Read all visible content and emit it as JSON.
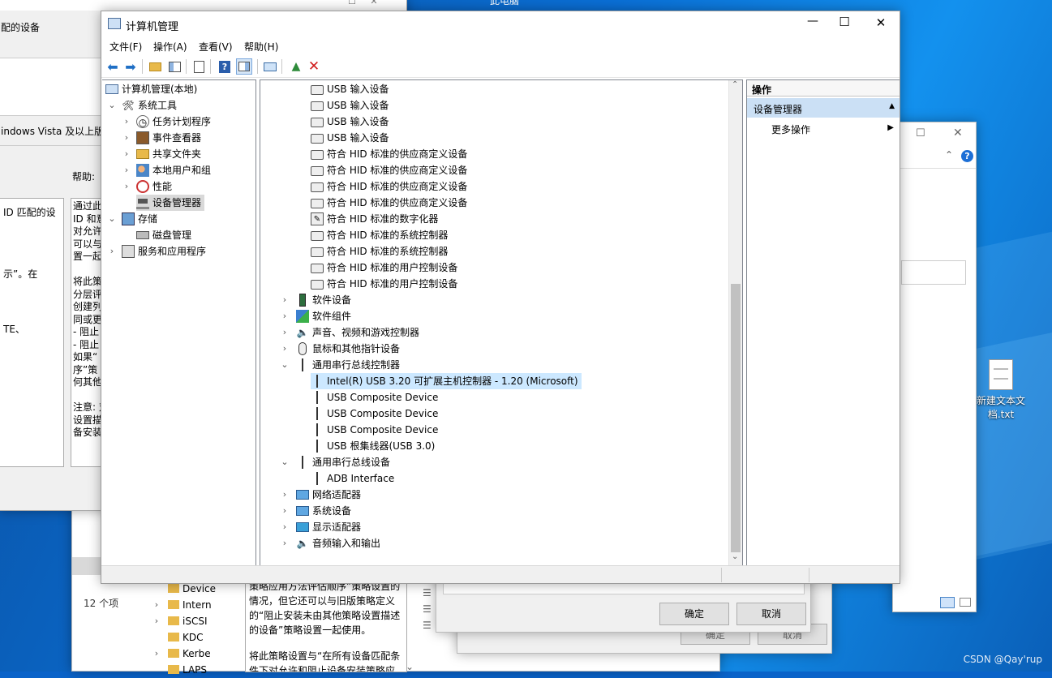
{
  "bg_left_window": {
    "title_partial": "配的设备",
    "vista_text": "indows Vista 及以上版",
    "help_label": "帮助:",
    "left_lines": [
      "ID 匹配的设",
      "",
      "",
      "示”。在",
      "",
      "",
      "TE、"
    ],
    "help_lines": [
      "通过此",
      "ID 和意",
      "对允许",
      "可以与",
      "置一起",
      "",
      "将此策",
      "分层评",
      "创建列",
      "同或更",
      "- 阻止",
      "- 阻止",
      "如果“",
      "序”策",
      "何其他",
      "",
      "注意: 对",
      "设置描",
      "备安装"
    ]
  },
  "bg_bottom_window": {
    "count_text": "12 个项",
    "folders": [
      "Device",
      "Intern",
      "iSCSI",
      "KDC",
      "Kerbe",
      "LAPS"
    ],
    "desc_lines": [
      "策略应用方法评估顺序”策略设置的",
      "情况，但它还可以与旧版策略定义",
      "的“阻止安装未由其他策略设置描述",
      "的设备”策略设置一起使用。",
      "",
      "将此策略设置与“在所有设备匹配条",
      "件下对允许和阻止设备安装策略应"
    ],
    "ok_label": "确定",
    "cancel_label": "取消"
  },
  "bg_right_window": {
    "help_icon": "?"
  },
  "desktop_icon": {
    "label_line1": "新建文本文",
    "label_line2": "档.txt"
  },
  "watermark": "CSDN @Qay'rup",
  "top_partial_text": "此电脑",
  "window": {
    "title": "计算机管理",
    "controls": {
      "minimize": "—",
      "maximize": "☐",
      "close": "✕"
    },
    "menu": [
      "文件(F)",
      "操作(A)",
      "查看(V)",
      "帮助(H)"
    ]
  },
  "tree": {
    "root": "计算机管理(本地)",
    "items": [
      {
        "label": "系统工具",
        "level": 1,
        "expander": "⌄",
        "icon": "tools-icon"
      },
      {
        "label": "任务计划程序",
        "level": 2,
        "expander": "›",
        "icon": "clock-icon"
      },
      {
        "label": "事件查看器",
        "level": 2,
        "expander": "›",
        "icon": "event-viewer-icon"
      },
      {
        "label": "共享文件夹",
        "level": 2,
        "expander": "›",
        "icon": "shared-folder-icon"
      },
      {
        "label": "本地用户和组",
        "level": 2,
        "expander": "›",
        "icon": "users-icon"
      },
      {
        "label": "性能",
        "level": 2,
        "expander": "›",
        "icon": "performance-icon"
      },
      {
        "label": "设备管理器",
        "level": 2,
        "expander": "",
        "icon": "device-manager-icon",
        "selected": true
      },
      {
        "label": "存储",
        "level": 1,
        "expander": "⌄",
        "icon": "storage-icon"
      },
      {
        "label": "磁盘管理",
        "level": 2,
        "expander": "",
        "icon": "disk-icon"
      },
      {
        "label": "服务和应用程序",
        "level": 1,
        "expander": "›",
        "icon": "services-icon"
      }
    ]
  },
  "devices": [
    {
      "label": "USB 输入设备",
      "level": 2,
      "icon": "hid-icon"
    },
    {
      "label": "USB 输入设备",
      "level": 2,
      "icon": "hid-icon"
    },
    {
      "label": "USB 输入设备",
      "level": 2,
      "icon": "hid-icon"
    },
    {
      "label": "USB 输入设备",
      "level": 2,
      "icon": "hid-icon"
    },
    {
      "label": "符合 HID 标准的供应商定义设备",
      "level": 2,
      "icon": "hid-icon"
    },
    {
      "label": "符合 HID 标准的供应商定义设备",
      "level": 2,
      "icon": "hid-icon"
    },
    {
      "label": "符合 HID 标准的供应商定义设备",
      "level": 2,
      "icon": "hid-icon"
    },
    {
      "label": "符合 HID 标准的供应商定义设备",
      "level": 2,
      "icon": "hid-icon"
    },
    {
      "label": "符合 HID 标准的数字化器",
      "level": 2,
      "icon": "digitizer-icon"
    },
    {
      "label": "符合 HID 标准的系统控制器",
      "level": 2,
      "icon": "hid-icon"
    },
    {
      "label": "符合 HID 标准的系统控制器",
      "level": 2,
      "icon": "hid-icon"
    },
    {
      "label": "符合 HID 标准的用户控制设备",
      "level": 2,
      "icon": "hid-icon"
    },
    {
      "label": "符合 HID 标准的用户控制设备",
      "level": 2,
      "icon": "hid-icon"
    },
    {
      "label": "软件设备",
      "level": 1,
      "expander": "›",
      "icon": "software-device-icon"
    },
    {
      "label": "软件组件",
      "level": 1,
      "expander": "›",
      "icon": "software-component-icon"
    },
    {
      "label": "声音、视频和游戏控制器",
      "level": 1,
      "expander": "›",
      "icon": "speaker-icon"
    },
    {
      "label": "鼠标和其他指针设备",
      "level": 1,
      "expander": "›",
      "icon": "mouse-icon"
    },
    {
      "label": "通用串行总线控制器",
      "level": 1,
      "expander": "⌄",
      "icon": "usb-icon"
    },
    {
      "label": "Intel(R) USB 3.20 可扩展主机控制器 - 1.20 (Microsoft)",
      "level": 2,
      "icon": "usb-icon",
      "selected": true
    },
    {
      "label": "USB Composite Device",
      "level": 2,
      "icon": "usb-icon"
    },
    {
      "label": "USB Composite Device",
      "level": 2,
      "icon": "usb-icon"
    },
    {
      "label": "USB Composite Device",
      "level": 2,
      "icon": "usb-icon"
    },
    {
      "label": "USB 根集线器(USB 3.0)",
      "level": 2,
      "icon": "usb-icon"
    },
    {
      "label": "通用串行总线设备",
      "level": 1,
      "expander": "⌄",
      "icon": "usb-icon"
    },
    {
      "label": "ADB Interface",
      "level": 2,
      "icon": "usb-icon"
    },
    {
      "label": "网络适配器",
      "level": 1,
      "expander": "›",
      "icon": "network-icon"
    },
    {
      "label": "系统设备",
      "level": 1,
      "expander": "›",
      "icon": "system-device-icon"
    },
    {
      "label": "显示适配器",
      "level": 1,
      "expander": "›",
      "icon": "display-icon"
    },
    {
      "label": "音频输入和输出",
      "level": 1,
      "expander": "›",
      "icon": "audio-icon"
    }
  ],
  "actions": {
    "header": "操作",
    "section": "设备管理器",
    "more": "更多操作"
  }
}
